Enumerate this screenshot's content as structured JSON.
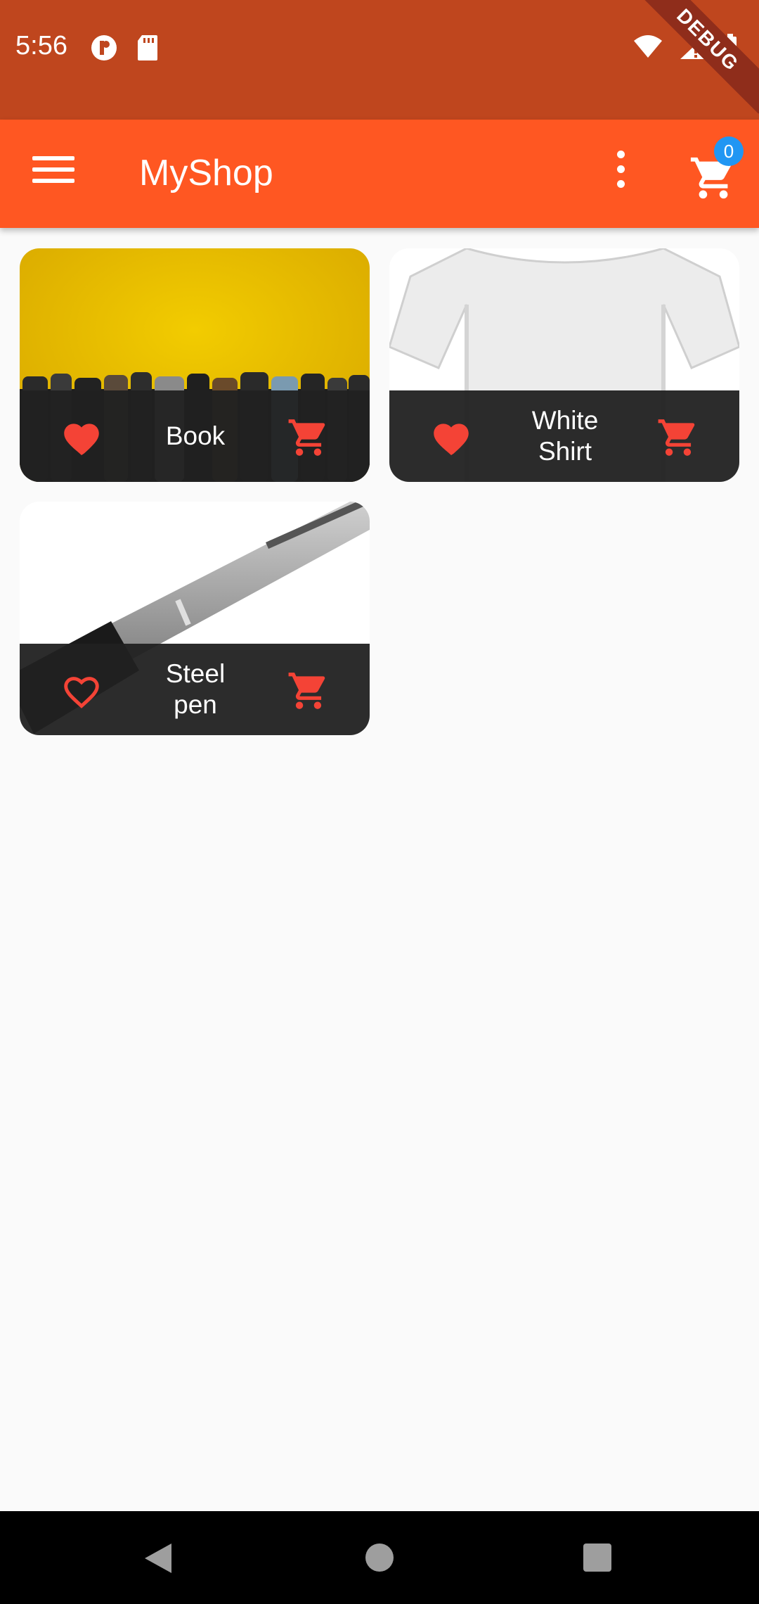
{
  "status_bar": {
    "time": "5:56",
    "left_icons": [
      "notification-p-icon",
      "sd-card-icon"
    ],
    "right_icons": [
      "wifi-icon",
      "signal-icon",
      "battery-icon"
    ],
    "debug_label": "DEBUG"
  },
  "app_bar": {
    "title": "MyShop",
    "menu_icon": "hamburger-menu-icon",
    "more_icon": "more-vert-icon",
    "cart_icon": "shopping-cart-icon",
    "cart_count": "0"
  },
  "colors": {
    "status_bar": "#bf461e",
    "app_bar": "#ff5722",
    "accent": "#f44336",
    "badge": "#2196f3",
    "tile_footer": "#212121"
  },
  "products": [
    {
      "title": "Book",
      "favorite": true,
      "image": "books-on-yellow-background"
    },
    {
      "title": "White Shirt",
      "favorite": true,
      "image": "white-t-shirt"
    },
    {
      "title": "Steel pen",
      "favorite": false,
      "image": "silver-pen"
    }
  ],
  "nav_bar": {
    "back_icon": "back-triangle-icon",
    "home_icon": "home-circle-icon",
    "recent_icon": "recent-apps-square-icon"
  }
}
